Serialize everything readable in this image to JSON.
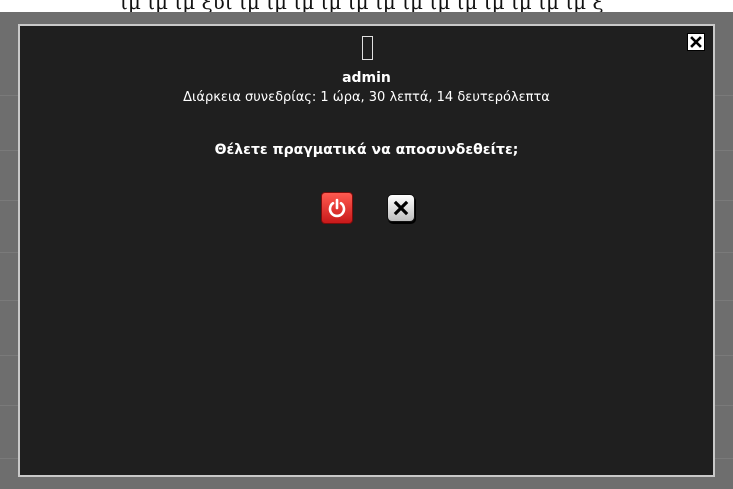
{
  "background": {
    "top_strip_text": "ιμ ιμ ιμ ξυι ιμ ιμ ιμ ιμ ιμ ιμ ιμ ιμ ιμ ιμ ιμ ιμ ιμ ξ"
  },
  "dialog": {
    "close_icon": "close-x-icon",
    "user_icon": "avatar-placeholder",
    "username": "admin",
    "session_duration": "Διάρκεια συνεδρίας: 1 ώρα, 30 λεπτά, 14 δευτερόλεπτα",
    "question": "Θέλετε πραγματικά να αποσυνδεθείτε;",
    "buttons": {
      "logout_icon": "power-icon",
      "cancel_icon": "close-x-icon"
    },
    "colors": {
      "panel": "#1f1f1f",
      "border": "#c9c9c9",
      "logout": "#e0312b"
    }
  }
}
